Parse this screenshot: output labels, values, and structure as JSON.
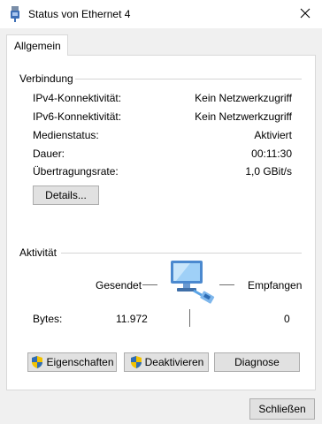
{
  "window": {
    "title": "Status von Ethernet 4"
  },
  "tabs": [
    {
      "label": "Allgemein"
    }
  ],
  "connection": {
    "heading": "Verbindung",
    "rows": [
      {
        "label": "IPv4-Konnektivität:",
        "value": "Kein Netzwerkzugriff"
      },
      {
        "label": "IPv6-Konnektivität:",
        "value": "Kein Netzwerkzugriff"
      },
      {
        "label": "Medienstatus:",
        "value": "Aktiviert"
      },
      {
        "label": "Dauer:",
        "value": "00:11:30"
      },
      {
        "label": "Übertragungsrate:",
        "value": "1,0 GBit/s"
      }
    ],
    "details_button": "Details..."
  },
  "activity": {
    "heading": "Aktivität",
    "sent_label": "Gesendet",
    "received_label": "Empfangen",
    "bytes_label": "Bytes:",
    "bytes_sent": "11.972",
    "bytes_received": "0"
  },
  "buttons": {
    "properties": "Eigenschaften",
    "disable": "Deaktivieren",
    "diagnose": "Diagnose",
    "close": "Schließen"
  },
  "icons": {
    "title_icon": "network-adapter-icon",
    "close": "close-icon",
    "network_activity": "network-computer-icon",
    "uac": "uac-shield-icon"
  },
  "colors": {
    "accent": "#0078d7",
    "button_face": "#e1e1e1",
    "button_border": "#adadad"
  }
}
